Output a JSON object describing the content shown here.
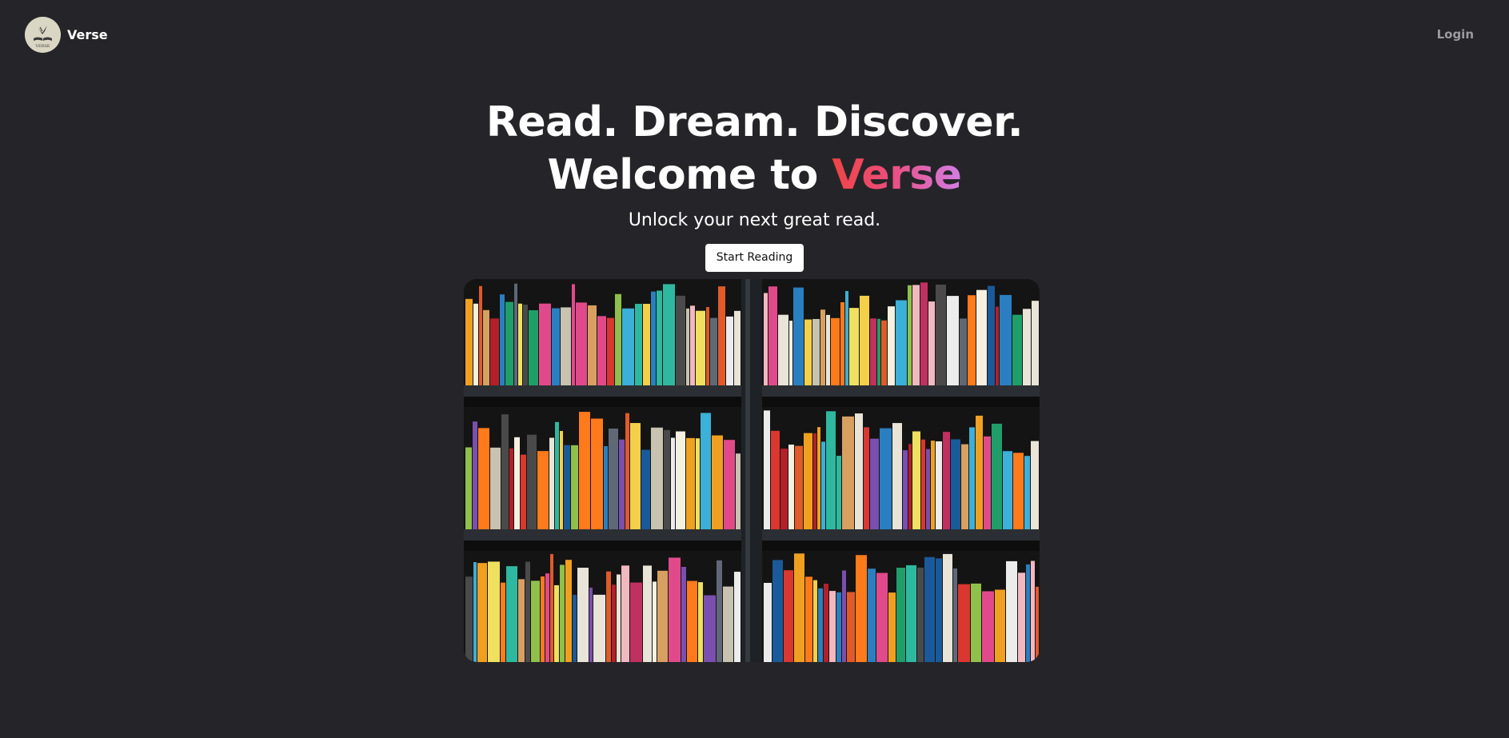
{
  "header": {
    "brand_name": "Verse",
    "logo_text": "VERSE",
    "logo_icon": "open-book-bird-icon",
    "login_label": "Login"
  },
  "hero": {
    "headline_line1": "Read. Dream. Discover.",
    "headline_line2_prefix": "Welcome to ",
    "headline_line2_accent": "Verse",
    "subtitle": "Unlock your next great read.",
    "cta_label": "Start Reading"
  },
  "image": {
    "alt": "Colorful books on dark bookshelves"
  },
  "colors": {
    "background": "#252529",
    "accent_start": "#ef4444",
    "accent_end": "#d27ee6",
    "cta_background": "#ffffff",
    "login_text": "#9b9ba0"
  }
}
